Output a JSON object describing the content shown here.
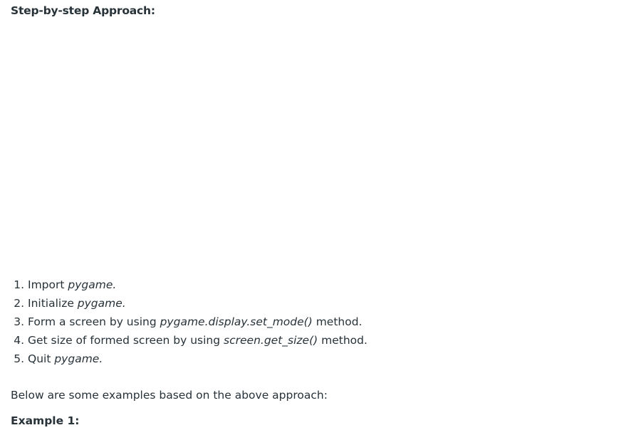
{
  "article": {
    "heading": "Step-by-step Approach:",
    "steps": [
      {
        "before": "Import ",
        "code": "pygame.",
        "after": ""
      },
      {
        "before": "Initialize ",
        "code": "pygame.",
        "after": ""
      },
      {
        "before": "Form a screen by using ",
        "code": "pygame.display.set_mode()",
        "after": " method."
      },
      {
        "before": "Get size of formed screen by using ",
        "code": "screen.get_size()",
        "after": " method."
      },
      {
        "before": "Quit ",
        "code": "pygame.",
        "after": ""
      }
    ],
    "intro_paragraph": "Below are some examples based on the above approach:",
    "example_heading": "Example 1:"
  },
  "colors": {
    "text": "#273239",
    "background": "#ffffff"
  }
}
